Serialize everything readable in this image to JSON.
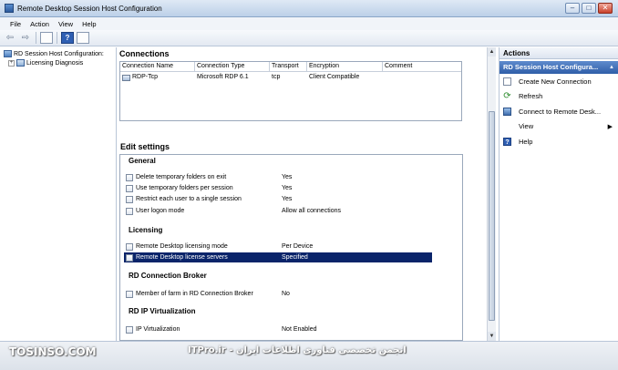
{
  "window": {
    "title": "Remote Desktop Session Host Configuration"
  },
  "menu": {
    "items": [
      "File",
      "Action",
      "View",
      "Help"
    ]
  },
  "tree": {
    "root": "RD Session Host Configuration:",
    "child": "Licensing Diagnosis"
  },
  "connections": {
    "heading": "Connections",
    "columns": [
      "Connection Name",
      "Connection Type",
      "Transport",
      "Encryption",
      "Comment"
    ],
    "rows": [
      {
        "name": "RDP-Tcp",
        "type": "Microsoft RDP 6.1",
        "transport": "tcp",
        "encryption": "Client Compatible",
        "comment": ""
      }
    ]
  },
  "edit_settings": {
    "heading": "Edit settings",
    "groups": [
      {
        "title": "General",
        "rows": [
          {
            "label": "Delete temporary folders on exit",
            "value": "Yes"
          },
          {
            "label": "Use temporary folders per session",
            "value": "Yes"
          },
          {
            "label": "Restrict each user to a single session",
            "value": "Yes"
          },
          {
            "label": "User logon mode",
            "value": "Allow all connections"
          }
        ]
      },
      {
        "title": "Licensing",
        "rows": [
          {
            "label": "Remote Desktop licensing mode",
            "value": "Per Device"
          },
          {
            "label": "Remote Desktop license servers",
            "value": "Specified",
            "selected": true
          }
        ]
      },
      {
        "title": "RD Connection Broker",
        "rows": [
          {
            "label": "Member of farm in RD Connection Broker",
            "value": "No"
          }
        ]
      },
      {
        "title": "RD IP Virtualization",
        "rows": [
          {
            "label": "IP Virtualization",
            "value": "Not Enabled"
          }
        ]
      }
    ]
  },
  "actions": {
    "heading": "Actions",
    "group": "RD Session Host Configura...",
    "items": [
      {
        "label": "Create New Connection",
        "icon": "new-connection-icon"
      },
      {
        "label": "Refresh",
        "icon": "refresh-icon"
      },
      {
        "label": "Connect to Remote Desk...",
        "icon": "remote-desktop-icon"
      },
      {
        "label": "View",
        "icon": "",
        "submenu": true
      },
      {
        "label": "Help",
        "icon": "help-icon"
      }
    ]
  },
  "watermark": {
    "left": "TOSINSO.COM",
    "right": "ITPro.ir - انجمن تخصصی فناوری اطلاعات ایران"
  }
}
